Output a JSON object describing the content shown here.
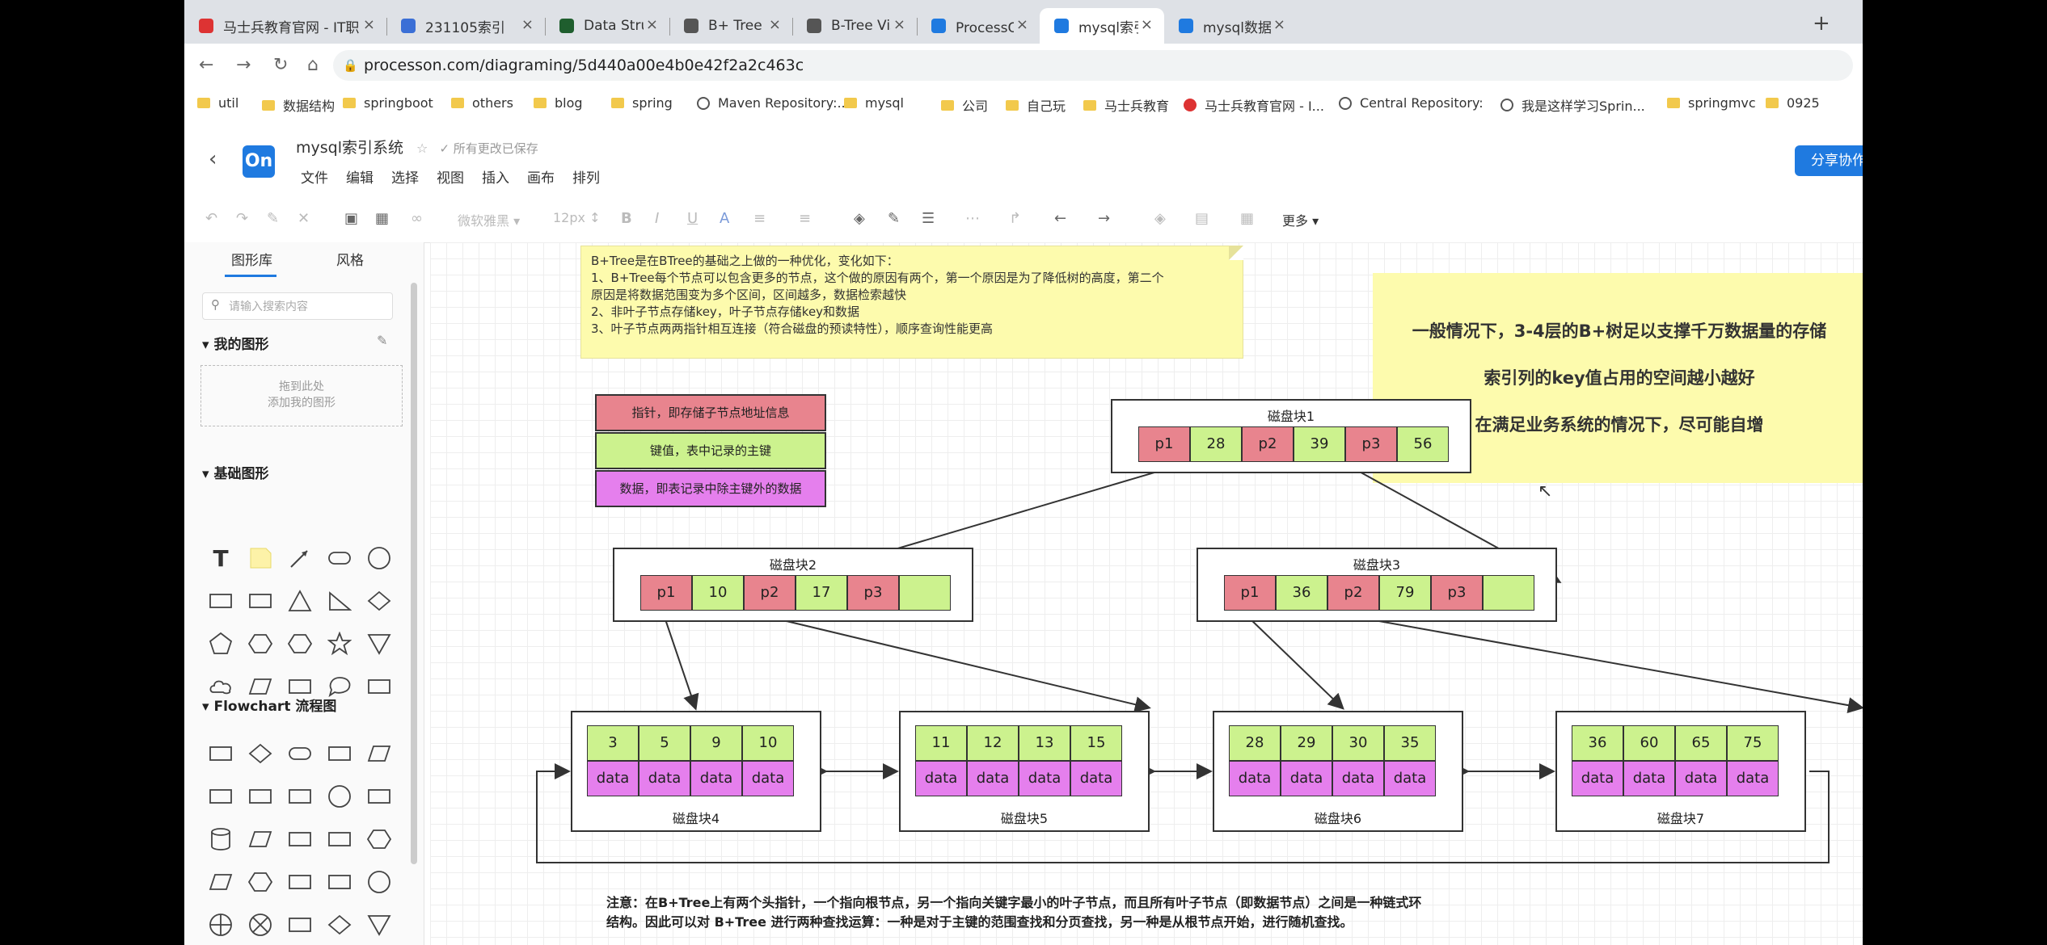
{
  "browser": {
    "tabs": [
      {
        "title": "马士兵教育官网 - IT职",
        "icon": "mashibing-icon",
        "color": "#d33"
      },
      {
        "title": "231105索引",
        "icon": "doc-icon",
        "color": "#3b6fd6"
      },
      {
        "title": "Data Structure Visual",
        "icon": "usf-icon",
        "color": "#1f5e2e"
      },
      {
        "title": "B+ Tree Visualization",
        "icon": "globe-icon",
        "color": "#555"
      },
      {
        "title": "B-Tree Visualization",
        "icon": "globe-icon",
        "color": "#555"
      },
      {
        "title": "ProcessOn - 我的文件",
        "icon": "processon-icon",
        "color": "#1f7ae0"
      },
      {
        "title": "mysql索引系统-Proce",
        "icon": "processon-icon",
        "color": "#1f7ae0"
      },
      {
        "title": "mysql数据结构选择-P",
        "icon": "processon-icon",
        "color": "#1f7ae0"
      }
    ],
    "new_tab": "+",
    "url": "processon.com/diagraming/5d440a00e4b0e42f2a2c463c",
    "bookmarks": [
      {
        "label": "util",
        "type": "folder"
      },
      {
        "label": "数据结构",
        "type": "folder"
      },
      {
        "label": "springboot",
        "type": "folder"
      },
      {
        "label": "others",
        "type": "folder"
      },
      {
        "label": "blog",
        "type": "folder"
      },
      {
        "label": "spring",
        "type": "folder"
      },
      {
        "label": "Maven Repository:...",
        "type": "site"
      },
      {
        "label": "mysql",
        "type": "folder"
      },
      {
        "label": "公司",
        "type": "folder"
      },
      {
        "label": "自己玩",
        "type": "folder"
      },
      {
        "label": "马士兵教育",
        "type": "folder"
      },
      {
        "label": "马士兵教育官网 - I...",
        "type": "redsite"
      },
      {
        "label": "Central Repository:",
        "type": "site"
      },
      {
        "label": "我是这样学习Sprin...",
        "type": "site"
      },
      {
        "label": "springmvc",
        "type": "folder"
      },
      {
        "label": "0925",
        "type": "folder"
      }
    ]
  },
  "app": {
    "logo": "On",
    "title": "mysql索引系统",
    "saved": "所有更改已保存",
    "menus": [
      "文件",
      "编辑",
      "选择",
      "视图",
      "插入",
      "画布",
      "排列"
    ],
    "share": "分享协作",
    "toolbar": {
      "font": "微软雅黑",
      "size": "12px",
      "more": "更多"
    }
  },
  "panel": {
    "tabs": [
      "图形库",
      "风格"
    ],
    "search_placeholder": "请输入搜索内容",
    "my_shapes": "我的图形",
    "drop_line1": "拖到此处",
    "drop_line2": "添加我的图形",
    "basic": "基础图形",
    "flowchart": "Flowchart 流程图"
  },
  "diagram": {
    "note_lines": [
      "B+Tree是在BTree的基础之上做的一种优化，变化如下：",
      "1、B+Tree每个节点可以包含更多的节点，这个做的原因有两个，第一个原因是为了降低树的高度，第二个",
      "原因是将数据范围变为多个区间，区间越多，数据检索越快",
      "2、非叶子节点存储key，叶子节点存储key和数据",
      "3、叶子节点两两指针相互连接（符合磁盘的预读特性），顺序查询性能更高"
    ],
    "highlights": [
      "一般情况下，3-4层的B+树足以支撑千万数据量的存储",
      "索引列的key值占用的空间越小越好",
      "在满足业务系统的情况下，尽可能自增"
    ],
    "legend": [
      {
        "label": "指针，即存储子节点地址信息",
        "color": "#e8848e"
      },
      {
        "label": "键值，表中记录的主键",
        "color": "#ccf28e"
      },
      {
        "label": "数据，即表记录中除主键外的数据",
        "color": "#e57fed"
      }
    ],
    "root": {
      "label": "磁盘块1",
      "cells": [
        "p1",
        "28",
        "p2",
        "39",
        "p3",
        "56"
      ]
    },
    "internal": [
      {
        "label": "磁盘块2",
        "cells": [
          "p1",
          "10",
          "p2",
          "17",
          "p3",
          ""
        ]
      },
      {
        "label": "磁盘块3",
        "cells": [
          "p1",
          "36",
          "p2",
          "79",
          "p3",
          ""
        ]
      }
    ],
    "leaves": [
      {
        "label": "磁盘块4",
        "keys": [
          "3",
          "5",
          "9",
          "10"
        ],
        "data": [
          "data",
          "data",
          "data",
          "data"
        ]
      },
      {
        "label": "磁盘块5",
        "keys": [
          "11",
          "12",
          "13",
          "15"
        ],
        "data": [
          "data",
          "data",
          "data",
          "data"
        ]
      },
      {
        "label": "磁盘块6",
        "keys": [
          "28",
          "29",
          "30",
          "35"
        ],
        "data": [
          "data",
          "data",
          "data",
          "data"
        ]
      },
      {
        "label": "磁盘块7",
        "keys": [
          "36",
          "60",
          "65",
          "75"
        ],
        "data": [
          "data",
          "data",
          "data",
          "data"
        ]
      }
    ],
    "footnote_line1": "注意：在B+Tree上有两个头指针，一个指向根节点，另一个指向关键字最小的叶子节点，而且所有叶子节点（即数据节点）之间是一种链式环",
    "footnote_line2": "结构。因此可以对 B+Tree 进行两种查找运算：一种是对于主键的范围查找和分页查找，另一种是从根节点开始，进行随机查找。"
  }
}
